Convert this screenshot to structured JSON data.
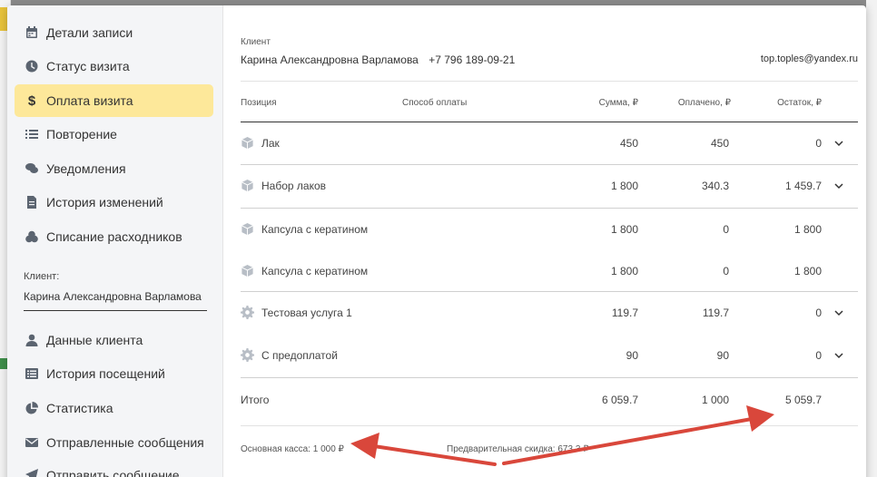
{
  "sidebar": {
    "items": [
      {
        "label": "Детали записи",
        "icon": "calendar-icon"
      },
      {
        "label": "Статус визита",
        "icon": "clock-icon"
      },
      {
        "label": "Оплата визита",
        "icon": "dollar-icon"
      },
      {
        "label": "Повторение",
        "icon": "list-icon"
      },
      {
        "label": "Уведомления",
        "icon": "chat-icon"
      },
      {
        "label": "История изменений",
        "icon": "document-icon"
      },
      {
        "label": "Списание расходников",
        "icon": "coins-icon"
      },
      {
        "label": "Данные клиента",
        "icon": "person-icon"
      },
      {
        "label": "История посещений",
        "icon": "table-icon"
      },
      {
        "label": "Статистика",
        "icon": "pie-chart-icon"
      },
      {
        "label": "Отправленные сообщения",
        "icon": "envelope-icon"
      },
      {
        "label": "Отправить сообщение",
        "icon": "send-icon"
      }
    ],
    "active_index": 2,
    "active_color": "#fde89a",
    "client_label": "Клиент:",
    "client_name": "Карина  Александровна Варламова"
  },
  "client": {
    "label": "Клиент",
    "name": "Карина Александровна Варламова",
    "phone": "+7 796 189-09-21",
    "email": "top.toples@yandex.ru"
  },
  "table": {
    "headers": {
      "position": "Позиция",
      "method": "Способ оплаты",
      "sum": "Сумма, ₽",
      "paid": "Оплачено, ₽",
      "rest": "Остаток, ₽"
    },
    "rows": [
      {
        "name": "Лак",
        "icon": "box-icon",
        "sum": "450",
        "paid": "450",
        "rest": "0",
        "expandable": true
      },
      {
        "name": "Набор лаков",
        "icon": "box-icon",
        "sum": "1 800",
        "paid": "340.3",
        "rest": "1 459.7",
        "expandable": true
      },
      {
        "name": "Капсула с кератином",
        "icon": "box-icon",
        "sum": "1 800",
        "paid": "0",
        "rest": "1 800",
        "expandable": false
      },
      {
        "name": "Капсула с кератином",
        "icon": "box-icon",
        "sum": "1 800",
        "paid": "0",
        "rest": "1 800",
        "expandable": false
      },
      {
        "name": "Тестовая услуга 1",
        "icon": "gear-icon",
        "sum": "119.7",
        "paid": "119.7",
        "rest": "0",
        "expandable": true
      },
      {
        "name": "С предоплатой",
        "icon": "gear-icon",
        "sum": "90",
        "paid": "90",
        "rest": "0",
        "expandable": true
      }
    ],
    "total": {
      "label": "Итого",
      "sum": "6 059.7",
      "paid": "1 000",
      "rest": "5 059.7"
    }
  },
  "footer": {
    "cash": "Основная касса: 1 000 ₽",
    "discount": "Предварительная скидка: 673.3 ₽"
  },
  "annotation_color": "#d9473b"
}
